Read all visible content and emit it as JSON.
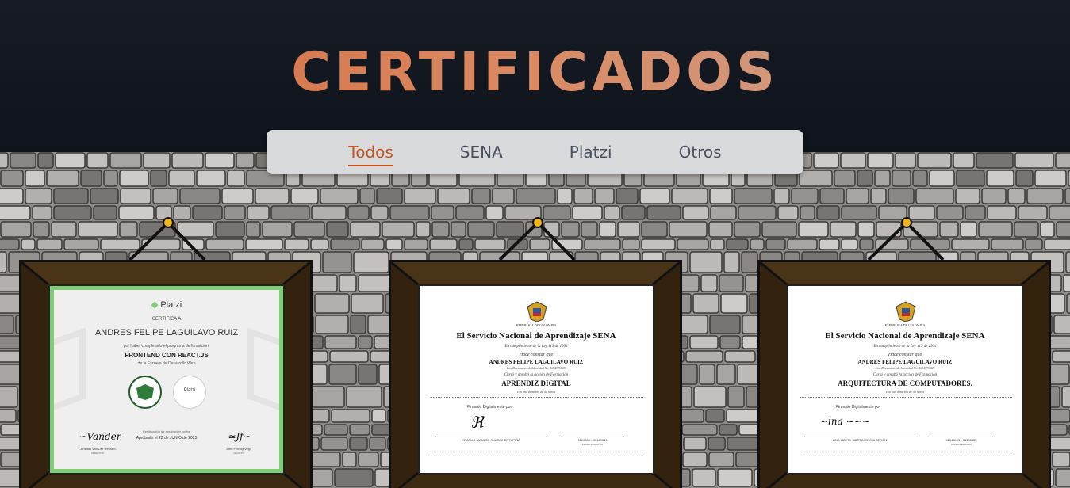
{
  "page": {
    "title": "CERTIFICADOS",
    "colors": {
      "accent": "#c4531f",
      "frame_wood": "#3d2a13",
      "tab_bar": "#d9dadc",
      "platzi_green": "#7fcf78"
    }
  },
  "tabs": [
    {
      "label": "Todos",
      "active": true
    },
    {
      "label": "SENA",
      "active": false
    },
    {
      "label": "Platzi",
      "active": false
    },
    {
      "label": "Otros",
      "active": false
    }
  ],
  "certificates": [
    {
      "issuer_logo": "Platzi",
      "certifica": "CERTIFICA A",
      "name": "ANDRES FELIPE LAGUILAVO RUIZ",
      "line1": "por haber completado el programa de formación:",
      "course": "FRONTEND CON REACT.JS",
      "school": "de la Escuela de Desarrollo Web",
      "seal_label": "Platzi",
      "approved_caption": "Certificación de aprobación online",
      "approved": "Aprobado el 22 de JUNIO de 2023",
      "signer1": "Christian Van Der Henst S.",
      "signer1_role": "DIRECTOR",
      "signer2": "John Freddy Vega",
      "signer2_role": "CEO/CTO"
    },
    {
      "country": "REPÚBLICA DE COLOMBIA",
      "heading": "El Servicio Nacional de Aprendizaje SENA",
      "law": "En cumplimiento de la Ley 119 de 1994",
      "hace_constar": "Hace constar que",
      "name": "ANDRES FELIPE LAGUILAVO RUIZ",
      "doc": "Con Documento de Identidad No. 1034776929",
      "cursed": "Cursó y aprobó la acción de Formación",
      "course": "APRENDIZ DIGITAL",
      "duration": "con una duración de 40 horas",
      "signed": "Firmado Digitalmente por",
      "signer": "ERASMO MANUEL SUAREZ ESTUPIÑA",
      "code": "9326850 - 30185939",
      "date_label": "FECHA REGISTRO"
    },
    {
      "country": "REPÚBLICA DE COLOMBIA",
      "heading": "El Servicio Nacional de Aprendizaje SENA",
      "law": "En cumplimiento de la Ley 119 de 1994",
      "hace_constar": "Hace constar que",
      "name": "ANDRES FELIPE LAGUILAVO RUIZ",
      "doc": "Con Documento de Identidad No. 1034776929",
      "cursed": "Cursó y aprobó la acción de Formación",
      "course": "ARQUITECTURA DE COMPUTADORES.",
      "duration": "con una duración de 40 horas",
      "signed": "Firmado Digitalmente por",
      "signer": "LINA LIZETH MARTINEZ CALDERON",
      "code": "92346451 - 34195939",
      "date_label": "FECHA REGISTRO"
    }
  ]
}
